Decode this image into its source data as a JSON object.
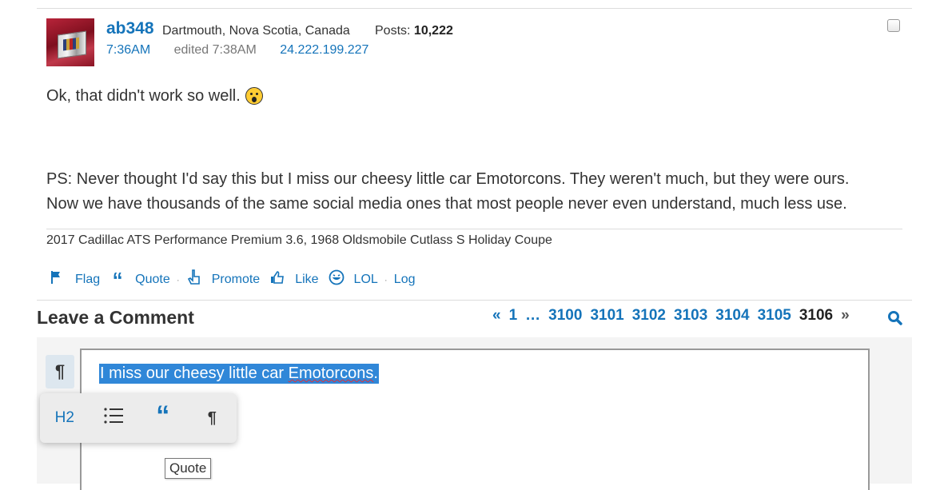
{
  "post": {
    "username": "ab348",
    "location": "Dartmouth, Nova Scotia, Canada",
    "posts_label": "Posts:",
    "posts_count": "10,222",
    "time": "7:36AM",
    "edited": "edited 7:38AM",
    "ip": "24.222.199.227",
    "line1": "Ok, that didn't work so well.",
    "emoji_icon": "surprised-face-icon",
    "line2": "PS: Never thought I'd say this but I miss our cheesy little car Emotorcons. They weren't much, but they were ours.",
    "line3": "Now we have thousands of the same social media ones that most people never even understand, much less use.",
    "signature": "2017 Cadillac ATS Performance Premium 3.6, 1968 Oldsmobile Cutlass S Holiday Coupe"
  },
  "actions": {
    "flag": "Flag",
    "quote": "Quote",
    "promote": "Promote",
    "like": "Like",
    "lol": "LOL",
    "log": "Log"
  },
  "comment": {
    "heading": "Leave a Comment",
    "editor_text": "I miss our cheesy little car Emotorcons.",
    "tooltip": "Quote"
  },
  "pager": {
    "prev": "«",
    "first": "1",
    "ellipsis": "…",
    "pages": [
      "3100",
      "3101",
      "3102",
      "3103",
      "3104",
      "3105"
    ],
    "current": "3106",
    "next": "»"
  },
  "toolbar": {
    "h2": "H2",
    "list_icon": "bullet-list-icon",
    "quote_glyph": "“",
    "para_glyph": "¶"
  },
  "colors": {
    "link": "#1574ba",
    "selection": "#3087d8"
  }
}
